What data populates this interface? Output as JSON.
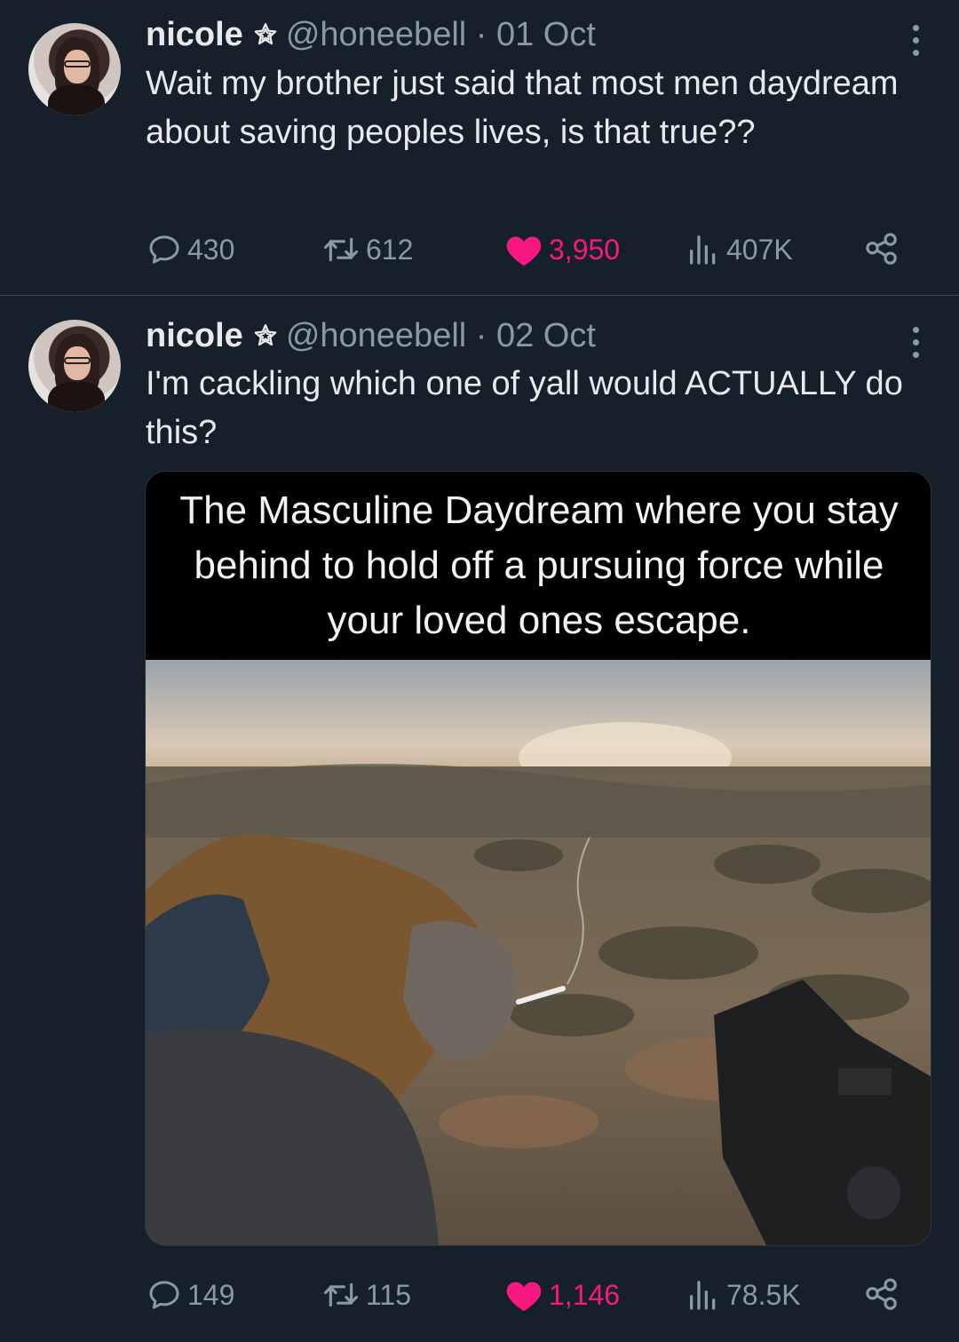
{
  "tweets": [
    {
      "name": "nicole",
      "handle": "@honeebell",
      "date": "01 Oct",
      "meta": "@honeebell · 01 Oct",
      "text": "Wait my brother just said that most men daydream about saving peoples lives, is that true??",
      "replies": "430",
      "retweets": "612",
      "likes": "3,950",
      "views": "407K",
      "avatar_icon": "profile-photo",
      "like_color": "#f91880"
    },
    {
      "name": "nicole",
      "handle": "@honeebell",
      "date": "02 Oct",
      "meta": "@honeebell · 02 Oct",
      "text": "I'm cackling which one of yall would ACTUALLY do this?",
      "media_caption": "The Masculine Daydream where you stay behind to hold off a pursuing force while your loved ones escape.",
      "replies": "149",
      "retweets": "115",
      "likes": "1,146",
      "views": "78.5K",
      "avatar_icon": "profile-photo",
      "like_color": "#f91880"
    }
  ],
  "colors": {
    "background": "#15202b",
    "text": "#e7e9ea",
    "muted": "#8b98a5",
    "like": "#f91880",
    "divider": "#38444d"
  }
}
